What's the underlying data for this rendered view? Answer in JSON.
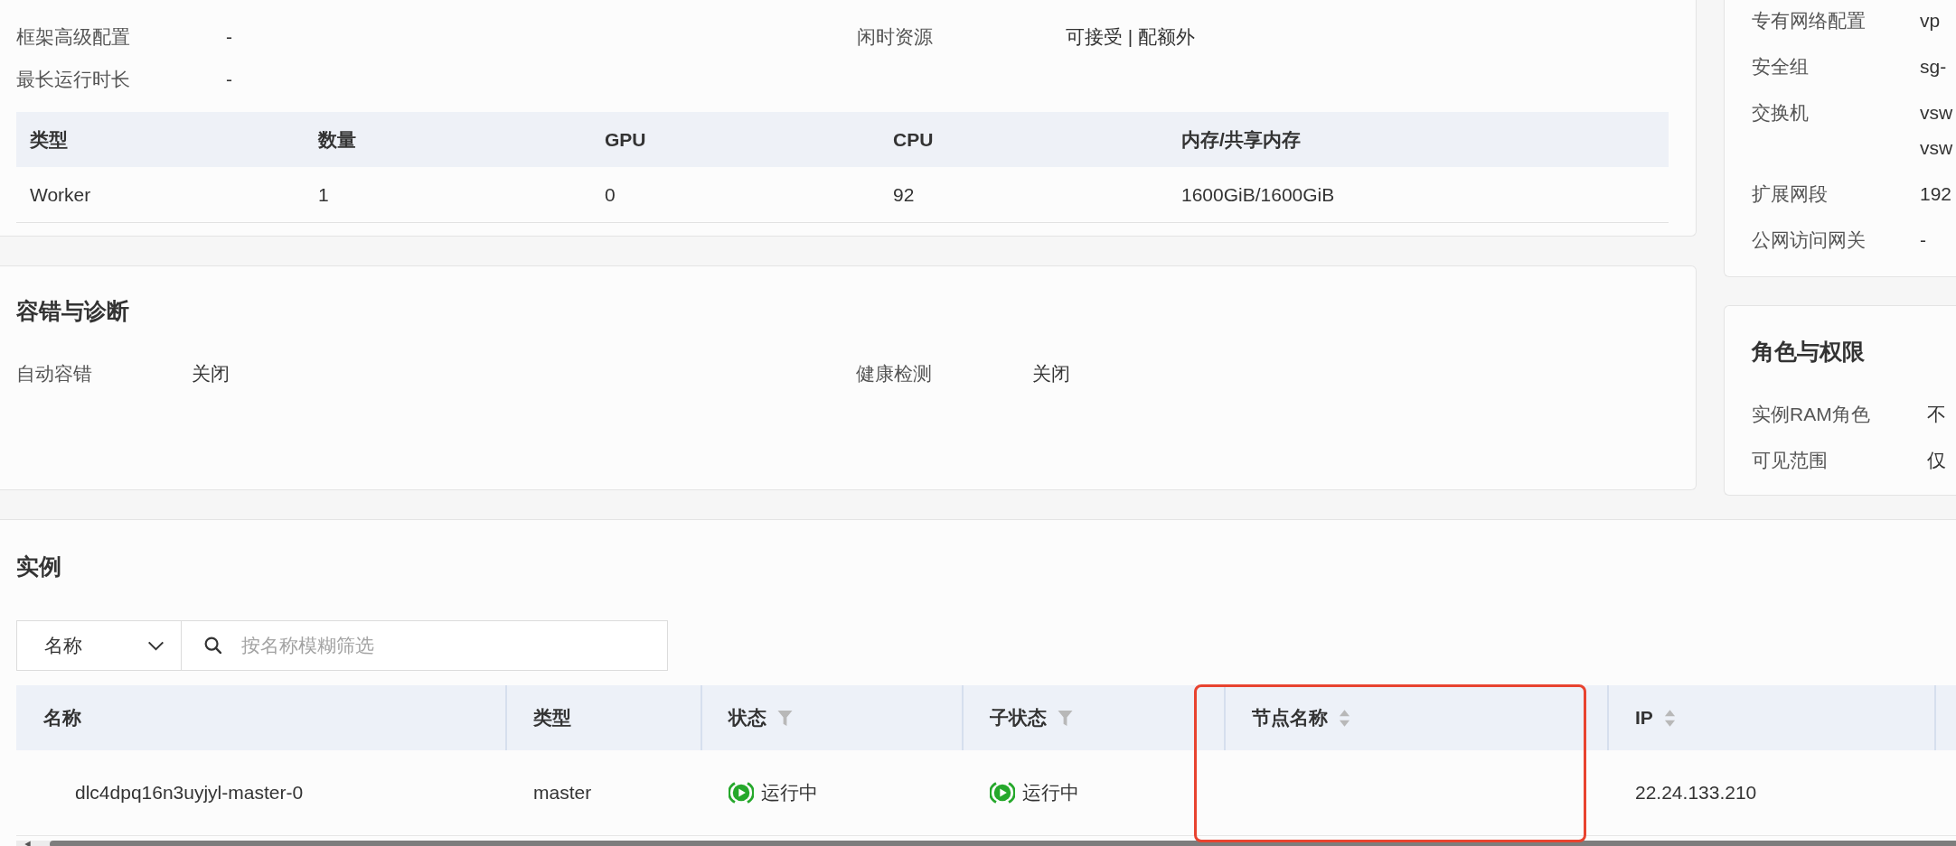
{
  "job_config": {
    "rows": [
      [
        {
          "label": "框架高级配置",
          "value": "-"
        },
        {
          "label": "闲时资源",
          "value": "可接受 | 配额外"
        }
      ],
      [
        {
          "label": "最长运行时长",
          "value": "-"
        }
      ]
    ],
    "table": {
      "columns": [
        "类型",
        "数量",
        "GPU",
        "CPU",
        "内存/共享内存"
      ],
      "rows": [
        [
          "Worker",
          "1",
          "0",
          "92",
          "1600GiB/1600GiB"
        ]
      ]
    }
  },
  "fault_tolerance": {
    "title": "容错与诊断",
    "items": [
      {
        "label": "自动容错",
        "value": "关闭"
      },
      {
        "label": "健康检测",
        "value": "关闭"
      }
    ]
  },
  "network": {
    "items": [
      {
        "label": "专有网络配置",
        "values": [
          "vp"
        ]
      },
      {
        "label": "安全组",
        "values": [
          "sg-"
        ]
      },
      {
        "label": "交换机",
        "values": [
          "vsw",
          "vsw"
        ]
      },
      {
        "label": "扩展网段",
        "values": [
          "192"
        ]
      },
      {
        "label": "公网访问网关",
        "values": [
          "-"
        ]
      }
    ]
  },
  "roles": {
    "title": "角色与权限",
    "items": [
      {
        "label": "实例RAM角色",
        "value": "不"
      },
      {
        "label": "可见范围",
        "value": "仅"
      }
    ]
  },
  "instances": {
    "title": "实例",
    "filter": {
      "field": "名称",
      "placeholder": "按名称模糊筛选"
    },
    "columns": [
      {
        "label": "名称",
        "kind": "plain",
        "highlighted": false
      },
      {
        "label": "类型",
        "kind": "plain",
        "highlighted": false
      },
      {
        "label": "状态",
        "kind": "filter",
        "highlighted": false
      },
      {
        "label": "子状态",
        "kind": "filter",
        "highlighted": false
      },
      {
        "label": "节点名称",
        "kind": "sort",
        "highlighted": true
      },
      {
        "label": "IP",
        "kind": "sort",
        "highlighted": false
      }
    ],
    "rows": [
      {
        "name": "dlc4dpq16n3uyjyl-master-0",
        "type": "master",
        "status": {
          "kind": "running",
          "text": "运行中"
        },
        "sub_status": {
          "kind": "running",
          "text": "运行中"
        },
        "ip": "22.24.133.210"
      }
    ]
  }
}
